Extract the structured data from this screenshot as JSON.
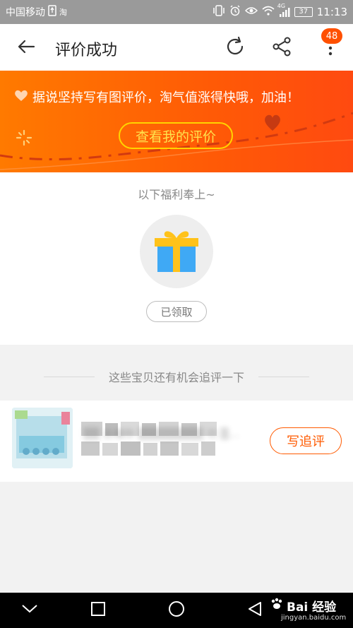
{
  "status_bar": {
    "carrier": "中国移动",
    "taobao_glyph": "淘",
    "battery": "37",
    "signal_label": "4G",
    "time": "11:13"
  },
  "header": {
    "title": "评价成功",
    "badge_count": "48"
  },
  "banner": {
    "message": "据说坚持写有图评价，淘气值涨得快哦，加油！",
    "button_label": "查看我的评价"
  },
  "welfare": {
    "title": "以下福利奉上~",
    "claimed_label": "已领取"
  },
  "followup": {
    "section_title": "这些宝贝还有机会追评一下",
    "product_name": "▒▒ 去帽你 ▒▒▒▒▒▒▒▒ 功 ▒▒▒▒ 以 ▒▒▒▒ 为 ▒▒ 页3C...",
    "button_label": "写追评"
  },
  "watermark": {
    "brand": "Bai 经验",
    "url": "jingyan.baidu.com"
  },
  "colors": {
    "accent": "#ff5000",
    "banner_start": "#ff7a00",
    "banner_end": "#ff4a10",
    "button_gold": "#ffd400"
  },
  "icons": {
    "back": "arrow-left-icon",
    "refresh": "refresh-icon",
    "share": "share-icon",
    "more": "more-vertical-icon",
    "gift": "gift-icon"
  }
}
